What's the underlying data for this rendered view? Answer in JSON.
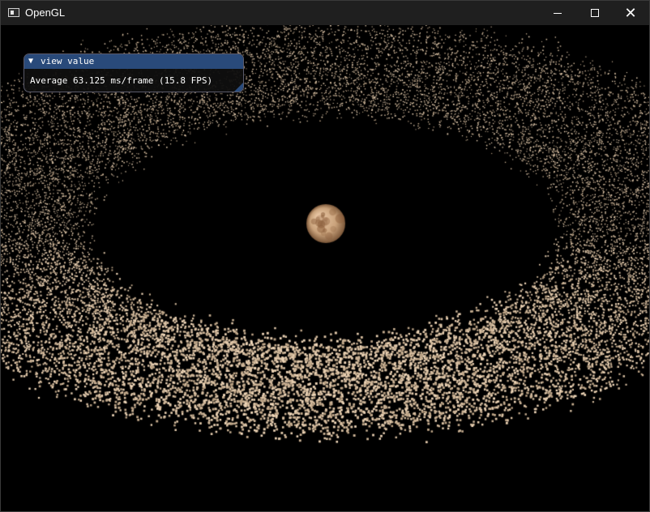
{
  "window": {
    "title": "OpenGL",
    "controls": {
      "minimize": "─",
      "maximize": "□",
      "close": "✕"
    }
  },
  "overlay": {
    "title": "view value",
    "collapse_arrow": "▼",
    "stats_text": "Average 63.125 ms/frame (15.8 FPS)"
  },
  "scene": {
    "background_color": "#000000",
    "planet_color": "#c9a27b",
    "asteroid_color": "#bfa08a",
    "asteroid_count": 21000,
    "icons": [
      "opengl-app-icon",
      "minimize-icon",
      "maximize-icon",
      "close-icon"
    ]
  }
}
